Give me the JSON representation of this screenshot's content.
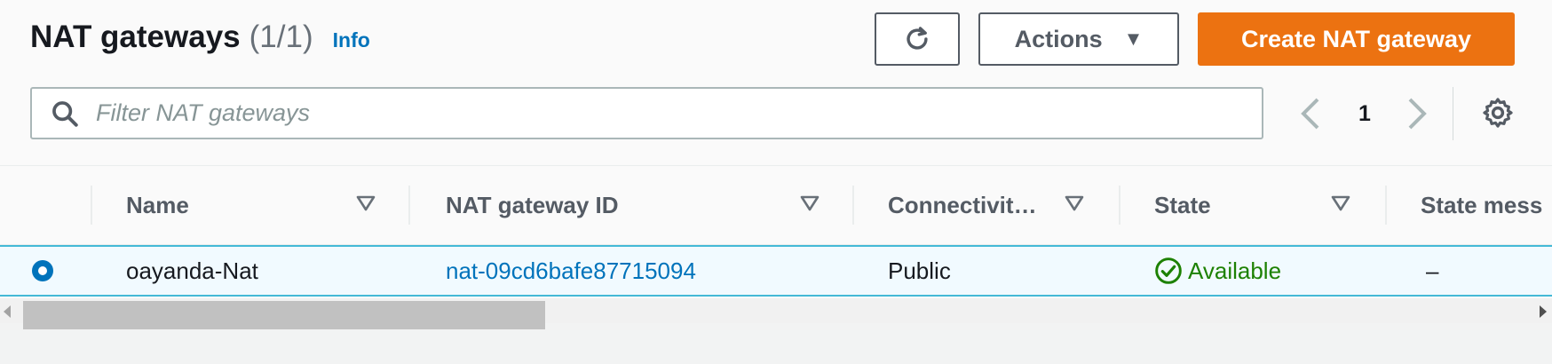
{
  "header": {
    "title": "NAT gateways",
    "count": "(1/1)",
    "info_label": "Info"
  },
  "toolbar": {
    "refresh_icon": "refresh-icon",
    "actions_label": "Actions",
    "actions_caret": "▼",
    "create_label": "Create NAT gateway",
    "create_color": "#ec7211"
  },
  "search": {
    "placeholder": "Filter NAT gateways",
    "value": ""
  },
  "pagination": {
    "prev": "‹",
    "current_page": "1",
    "next": "›"
  },
  "table": {
    "columns": [
      "Name",
      "NAT gateway ID",
      "Connectivit…",
      "State",
      "State mess"
    ],
    "rows": [
      {
        "selected": true,
        "name": "oayanda-Nat",
        "nat_gateway_id": "nat-09cd6bafe87715094",
        "connectivity": "Public",
        "state": "Available",
        "state_message": "–"
      }
    ]
  },
  "colors": {
    "link": "#0073bb",
    "status_available": "#1d8102",
    "selected_row_border": "#44b9d6"
  }
}
